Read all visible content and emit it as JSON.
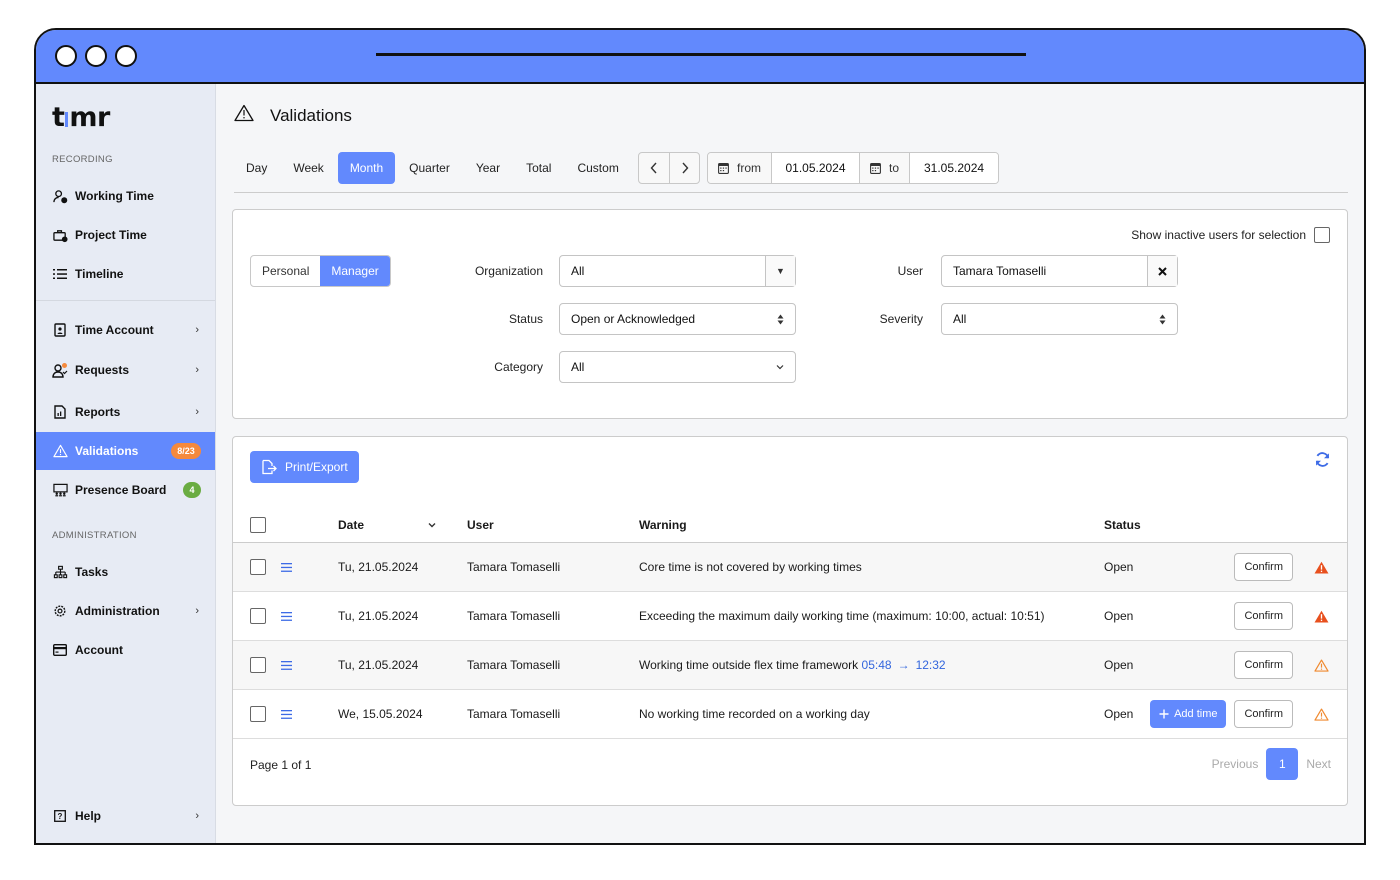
{
  "app": {
    "logo": "timr"
  },
  "sidebar": {
    "sections": {
      "recording": "RECORDING",
      "administration": "ADMINISTRATION"
    },
    "items": [
      {
        "label": "Working Time",
        "icon": "user-clock-icon"
      },
      {
        "label": "Project Time",
        "icon": "briefcase-clock-icon"
      },
      {
        "label": "Timeline",
        "icon": "list-icon"
      },
      {
        "label": "Time Account",
        "icon": "document-user-icon",
        "chevron": true
      },
      {
        "label": "Requests",
        "icon": "user-check-icon",
        "chevron": true,
        "dot": true
      },
      {
        "label": "Reports",
        "icon": "report-icon",
        "chevron": true
      },
      {
        "label": "Validations",
        "icon": "warning-icon",
        "badge": "8/23",
        "active": true
      },
      {
        "label": "Presence Board",
        "icon": "presence-icon",
        "badge": "4"
      },
      {
        "label": "Tasks",
        "icon": "hierarchy-icon"
      },
      {
        "label": "Administration",
        "icon": "gear-icon",
        "chevron": true
      },
      {
        "label": "Account",
        "icon": "credit-card-icon"
      },
      {
        "label": "Help",
        "icon": "help-icon",
        "chevron": true
      }
    ]
  },
  "header": {
    "title": "Validations"
  },
  "period": {
    "tabs": [
      "Day",
      "Week",
      "Month",
      "Quarter",
      "Year",
      "Total",
      "Custom"
    ],
    "active": "Month",
    "from_label": "from",
    "from_value": "01.05.2024",
    "to_label": "to",
    "to_value": "31.05.2024"
  },
  "filters": {
    "mode_tabs": [
      "Personal",
      "Manager"
    ],
    "mode_active": "Manager",
    "show_inactive_label": "Show inactive users for selection",
    "show_inactive_checked": false,
    "organization_label": "Organization",
    "organization_value": "All",
    "status_label": "Status",
    "status_value": "Open or Acknowledged",
    "category_label": "Category",
    "category_value": "All",
    "user_label": "User",
    "user_value": "Tamara Tomaselli",
    "severity_label": "Severity",
    "severity_value": "All"
  },
  "table": {
    "print_label": "Print/Export",
    "columns": {
      "date": "Date",
      "user": "User",
      "warning": "Warning",
      "status": "Status"
    },
    "rows": [
      {
        "date": "Tu, 21.05.2024",
        "user": "Tamara Tomaselli",
        "warning": "Core time is not covered by working times",
        "status": "Open",
        "confirm": "Confirm",
        "severity": "error"
      },
      {
        "date": "Tu, 21.05.2024",
        "user": "Tamara Tomaselli",
        "warning": "Exceeding the maximum daily working time (maximum: 10:00, actual: 10:51)",
        "status": "Open",
        "confirm": "Confirm",
        "severity": "error"
      },
      {
        "date": "Tu, 21.05.2024",
        "user": "Tamara Tomaselli",
        "warning": "Working time outside flex time framework",
        "time_from": "05:48",
        "arrow": "→",
        "time_to": "12:32",
        "status": "Open",
        "confirm": "Confirm",
        "severity": "warning"
      },
      {
        "date": "We, 15.05.2024",
        "user": "Tamara Tomaselli",
        "warning": "No working time recorded on a working day",
        "status": "Open",
        "add_time": "Add time",
        "confirm": "Confirm",
        "severity": "warning"
      }
    ],
    "page_info": "Page 1 of 1",
    "previous": "Previous",
    "current_page": "1",
    "next": "Next"
  },
  "colors": {
    "accent": "#6289fd",
    "error": "#e8501e",
    "warning": "#f08a30",
    "badge_orange": "#f5893c",
    "badge_green": "#6aac42"
  }
}
